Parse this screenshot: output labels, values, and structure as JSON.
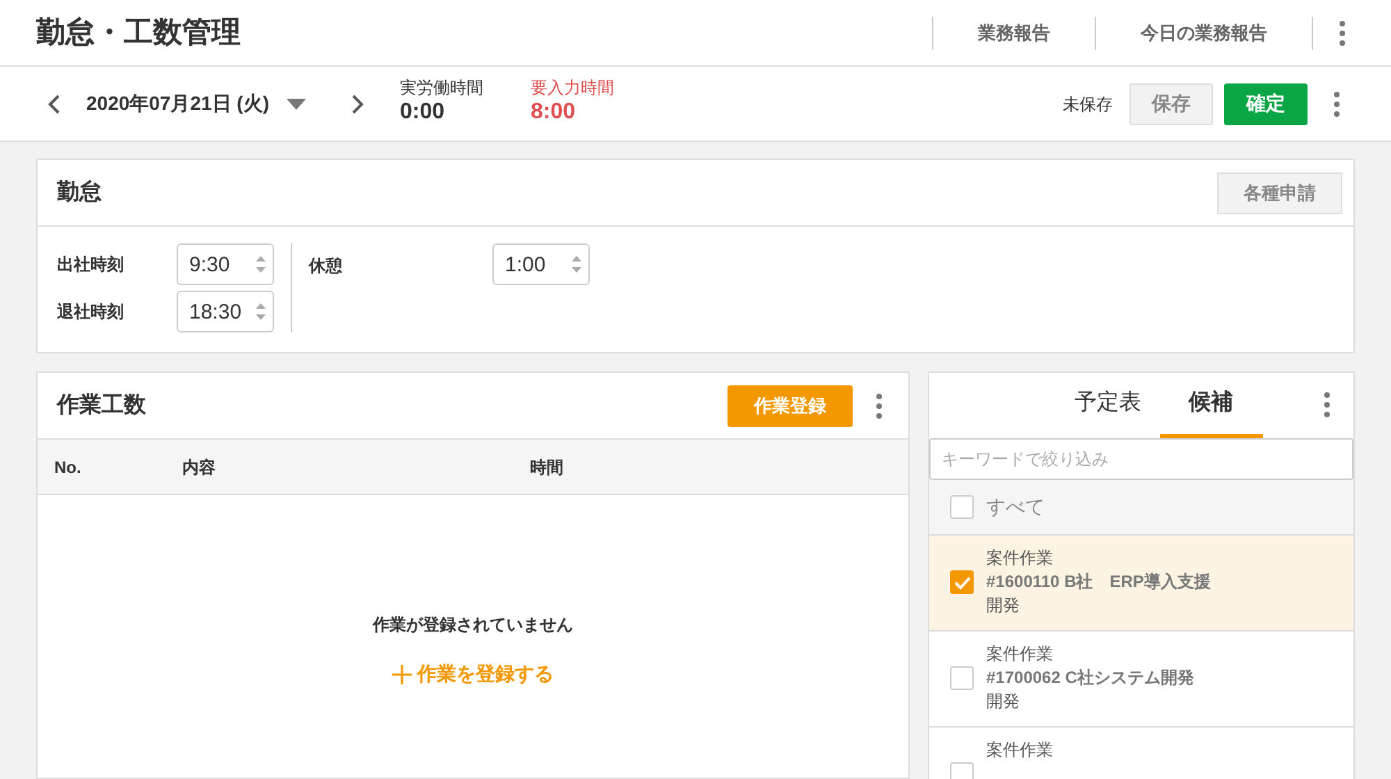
{
  "header": {
    "title": "勤怠・工数管理",
    "links": [
      "業務報告",
      "今日の業務報告"
    ]
  },
  "toolbar": {
    "date": "2020年07月21日 (火)",
    "stats": [
      {
        "label": "実労働時間",
        "value": "0:00",
        "kind": "normal"
      },
      {
        "label": "要入力時間",
        "value": "8:00",
        "kind": "alert"
      }
    ],
    "status": "未保存",
    "save": {
      "label": "保存",
      "disabled": true
    },
    "confirm": "確定"
  },
  "attendance": {
    "title": "勤怠",
    "request_button": "各種申請",
    "fields": [
      {
        "label": "出社時刻",
        "value": "9:30"
      },
      {
        "label": "退社時刻",
        "value": "18:30"
      }
    ],
    "break": {
      "label": "休憩",
      "value": "1:00"
    }
  },
  "work": {
    "title": "作業工数",
    "register_button": "作業登録",
    "columns": [
      "No.",
      "内容",
      "時間"
    ],
    "empty_message": "作業が登録されていません",
    "add_link": "作業を登録する"
  },
  "candidates": {
    "tabs": [
      {
        "label": "予定表",
        "selected": false
      },
      {
        "label": "候補",
        "selected": true
      }
    ],
    "search": {
      "placeholder": "キーワードで絞り込み"
    },
    "all": {
      "label": "すべて",
      "checked": false
    },
    "items": [
      {
        "category": "案件作業",
        "project": "#1600110 B社　ERP導入支援",
        "phase": "開発",
        "checked": true
      },
      {
        "category": "案件作業",
        "project": "#1700062 C社システム開発",
        "phase": "開発",
        "checked": false
      },
      {
        "category": "案件作業",
        "checked": false
      }
    ]
  }
}
